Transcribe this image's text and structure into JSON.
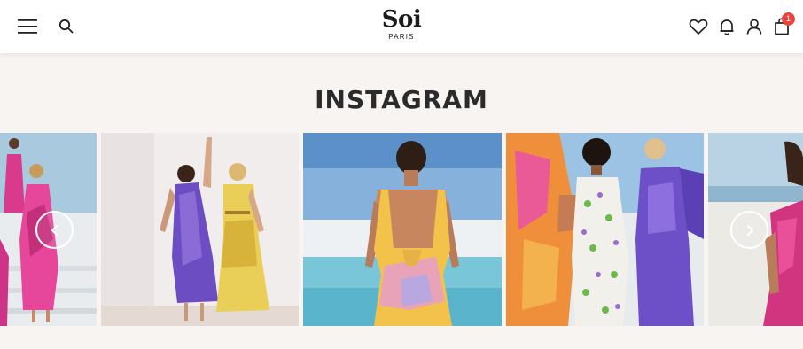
{
  "brand": {
    "name": "Soi",
    "sub": "PARIS"
  },
  "header": {
    "cart_count": "1",
    "icons": [
      "menu-icon",
      "search-icon",
      "heart-icon",
      "bell-icon",
      "user-icon",
      "shopping-bag-icon"
    ]
  },
  "instagram": {
    "title": "INSTAGRAM",
    "tiles": [
      "pink-dress-stairs-photo",
      "two-models-purple-yellow-dresses-photo",
      "yellow-backless-dress-pool-photo",
      "three-models-printed-dresses-photo",
      "pink-dress-seaside-photo"
    ],
    "controls": [
      "chevron-left-icon",
      "chevron-right-icon"
    ]
  },
  "colors": {
    "page_background": "#f8f4f1",
    "header_background": "#ffffff",
    "badge": "#e8453c",
    "text": "#2b2b2b"
  }
}
